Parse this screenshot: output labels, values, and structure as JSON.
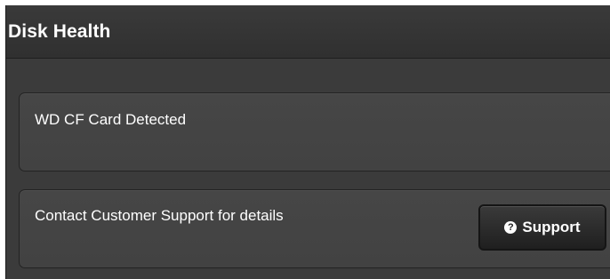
{
  "header": {
    "title": "Disk Health"
  },
  "cards": [
    {
      "message": "WD CF Card Detected"
    },
    {
      "message": "Contact Customer Support for details",
      "button_label": "Support",
      "button_icon": "question-circle-icon"
    }
  ],
  "colors": {
    "header_bg": "#333333",
    "panel_bg": "#3b3b3b",
    "card_bg": "#444444",
    "button_bg": "#262626",
    "text": "#ffffff"
  }
}
